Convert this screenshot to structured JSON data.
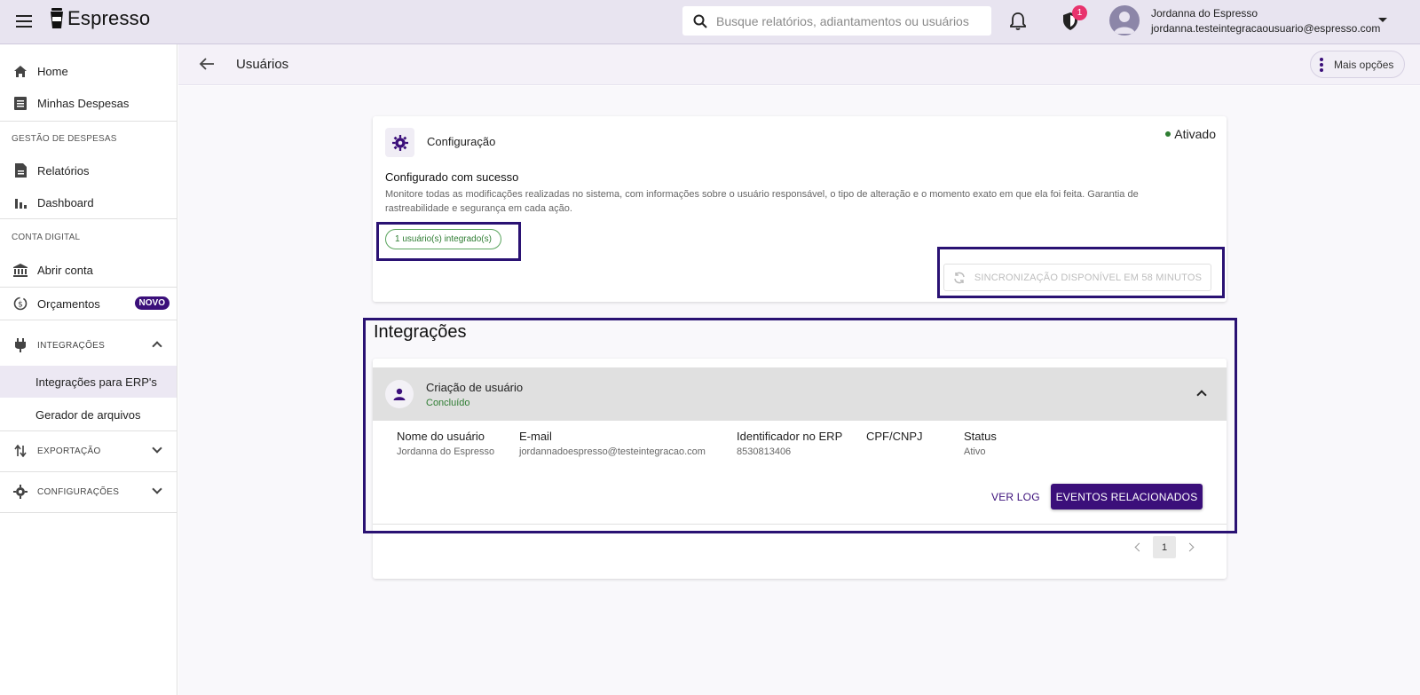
{
  "app": {
    "name": "Espresso"
  },
  "search": {
    "placeholder": "Busque relatórios, adiantamentos ou usuários"
  },
  "notifications": {
    "shield_badge": "1"
  },
  "user": {
    "name": "Jordanna do Espresso",
    "email": "jordanna.testeintegracaousuario@espresso.com"
  },
  "sidebar": {
    "home": "Home",
    "minhas_despesas": "Minhas Despesas",
    "section_gestao": "GESTÃO DE DESPESAS",
    "relatorios": "Relatórios",
    "dashboard": "Dashboard",
    "section_conta": "CONTA DIGITAL",
    "abrir_conta": "Abrir conta",
    "orcamentos": "Orçamentos",
    "novo_badge": "NOVO",
    "integracoes": "INTEGRAÇÕES",
    "integracoes_erp": "Integrações para ERP's",
    "gerador_arquivos": "Gerador de arquivos",
    "exportacao": "EXPORTAÇÃO",
    "configuracoes": "CONFIGURAÇÕES"
  },
  "header": {
    "title": "Usuários",
    "more_options": "Mais opções"
  },
  "config": {
    "title": "Configuração",
    "status": "Ativado",
    "status_color": "#2e7d32",
    "success_title": "Configurado com sucesso",
    "description": "Monitore todas as modificações realizadas no sistema, com informações sobre o usuário responsável, o tipo de alteração e o momento exato em que ela foi feita. Garantia de rastreabilidade e segurança em cada ação.",
    "chip": "1 usuário(s) integrado(s)",
    "sync_button": "SINCRONIZAÇÃO DISPONÍVEL EM 58 MINUTOS"
  },
  "integrations": {
    "heading": "Integrações",
    "item": {
      "title": "Criação de usuário",
      "status": "Concluído",
      "fields": [
        {
          "label": "Nome do usuário",
          "value": "Jordanna do Espresso"
        },
        {
          "label": "E-mail",
          "value": "jordannadoespresso@testeintegracao.com"
        },
        {
          "label": "Identificador no ERP",
          "value": "8530813406"
        },
        {
          "label": "CPF/CNPJ",
          "value": ""
        },
        {
          "label": "Status",
          "value": "Ativo"
        }
      ],
      "ver_log": "VER LOG",
      "eventos": "EVENTOS RELACIONADOS"
    },
    "page": "1"
  },
  "colors": {
    "brand": "#3b0f7a",
    "topbar": "#e8e4f0",
    "highlight": "#2a1273",
    "badge": "#e8336d"
  }
}
